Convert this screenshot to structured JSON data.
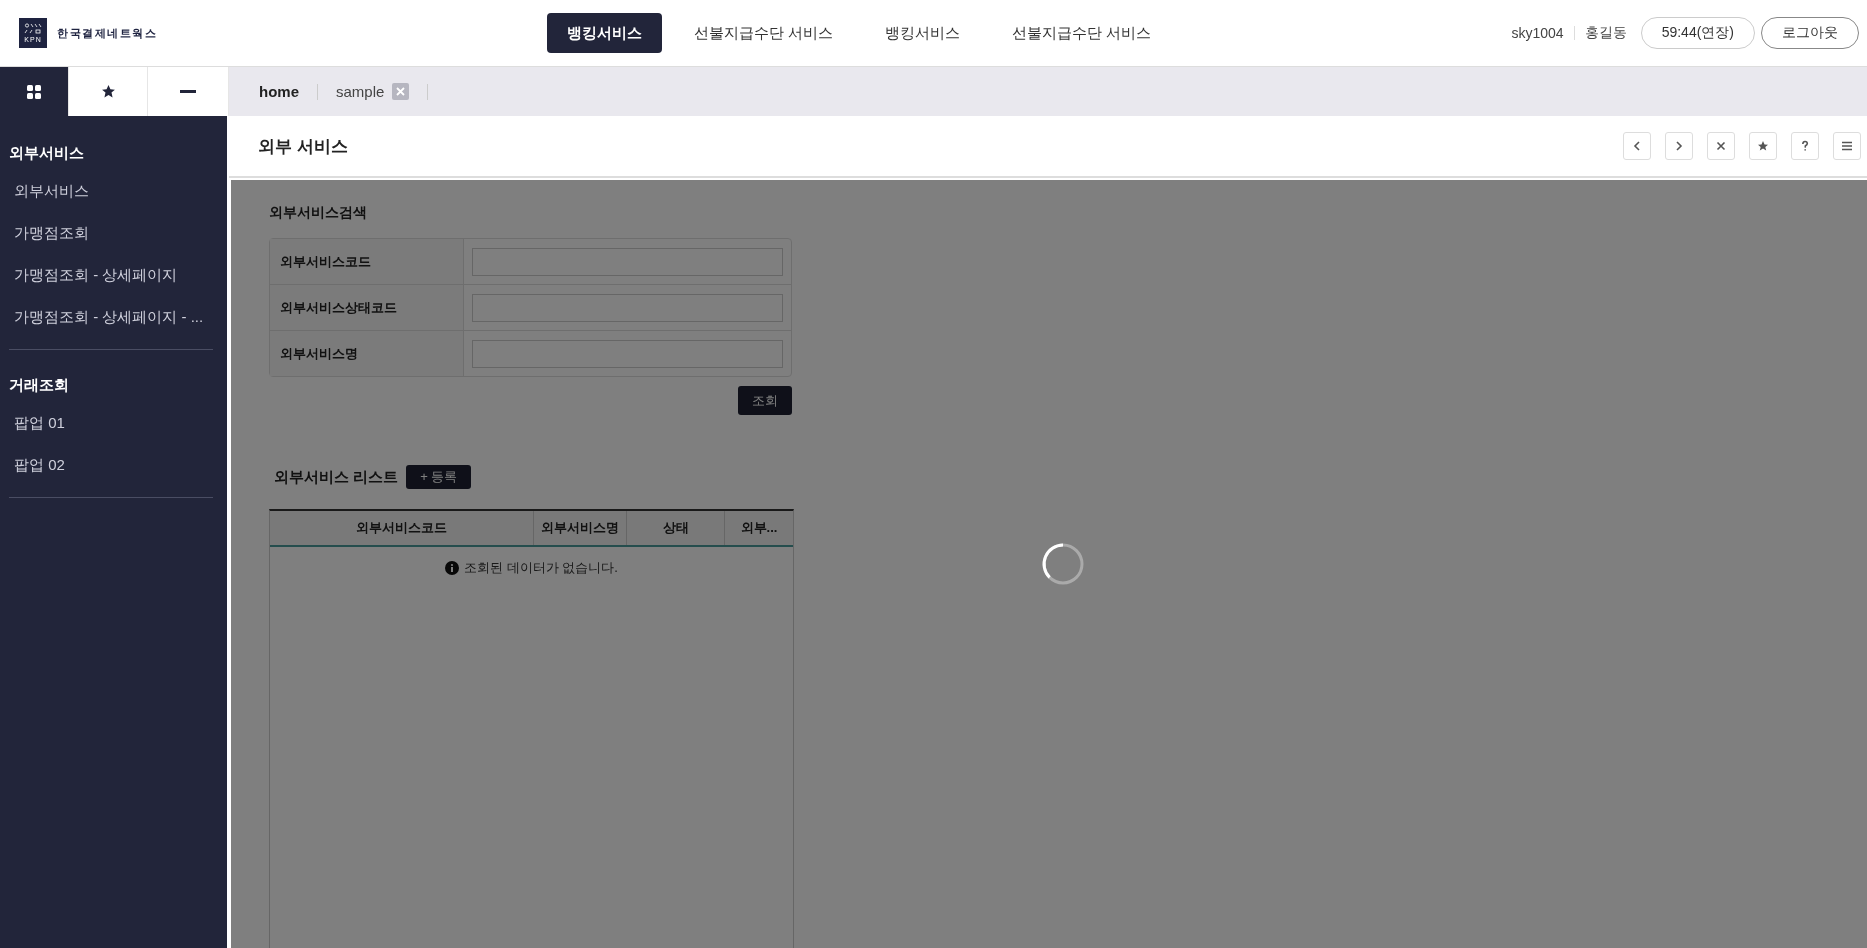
{
  "header": {
    "logo": {
      "mark_text": "KPN",
      "company": "한국결제네트웍스"
    },
    "nav": [
      {
        "label": "뱅킹서비스",
        "selected": true
      },
      {
        "label": "선불지급수단 서비스",
        "selected": false
      },
      {
        "label": "뱅킹서비스",
        "selected": false
      },
      {
        "label": "선불지급수단 서비스",
        "selected": false
      }
    ],
    "user_id": "sky1004",
    "user_name": "홍길동",
    "session_timer": "59:44(연장)",
    "logout": "로그아웃"
  },
  "sidebar": {
    "tabs": [
      {
        "kind": "grid",
        "selected": true
      },
      {
        "kind": "star",
        "selected": false
      },
      {
        "kind": "minus",
        "selected": false
      }
    ],
    "groups": [
      {
        "title": "외부서비스",
        "items": [
          "외부서비스",
          "가맹점조회",
          "가맹점조회 - 상세페이지",
          "가맹점조회 - 상세페이지 - ..."
        ]
      },
      {
        "title": "거래조회",
        "items": [
          "팝업 01",
          "팝업 02"
        ]
      }
    ]
  },
  "tabs": [
    {
      "label": "home",
      "selected": true,
      "closable": false
    },
    {
      "label": "sample",
      "selected": false,
      "closable": true
    }
  ],
  "page": {
    "title": "외부 서비스",
    "toolbar": [
      {
        "kind": "back"
      },
      {
        "kind": "forward"
      },
      {
        "kind": "close"
      },
      {
        "kind": "star"
      },
      {
        "kind": "help"
      },
      {
        "kind": "menu"
      }
    ]
  },
  "search": {
    "title": "외부서비스검색",
    "fields": [
      {
        "label": "외부서비스코드"
      },
      {
        "label": "외부서비스상태코드"
      },
      {
        "label": "외부서비스명"
      }
    ],
    "submit": "조회"
  },
  "list": {
    "title": "외부서비스 리스트",
    "add_button": "+ 등록",
    "columns": [
      "외부서비스코드",
      "외부서비스명",
      "상태",
      "외부..."
    ],
    "empty_message": "조회된 데이터가 없습니다."
  },
  "loading": true
}
